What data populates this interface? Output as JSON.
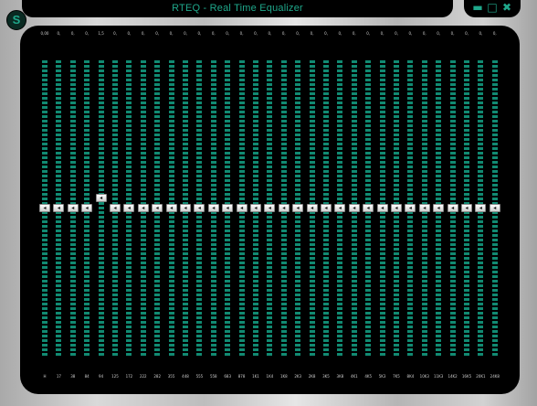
{
  "window": {
    "title": "RTEQ - Real Time Equalizer",
    "skin_button": "S",
    "minimize": "▬",
    "maximize": "□",
    "close": "✖"
  },
  "colors": {
    "accent": "#1fa88b",
    "meter": "#118a72",
    "panel": "#000000"
  },
  "equalizer": {
    "knob_glyph": "◂",
    "bands": [
      {
        "freq": "H",
        "gain": "0,00",
        "level": 0.5
      },
      {
        "freq": "17",
        "gain": "0,",
        "level": 0.5
      },
      {
        "freq": "38",
        "gain": "0,",
        "level": 0.5
      },
      {
        "freq": "84",
        "gain": "0,",
        "level": 0.5
      },
      {
        "freq": "94",
        "gain": "1,5",
        "level": 0.535
      },
      {
        "freq": "125",
        "gain": "0,",
        "level": 0.5
      },
      {
        "freq": "172",
        "gain": "0,",
        "level": 0.5
      },
      {
        "freq": "222",
        "gain": "0,",
        "level": 0.5
      },
      {
        "freq": "282",
        "gain": "0,",
        "level": 0.5
      },
      {
        "freq": "355",
        "gain": "0,",
        "level": 0.5
      },
      {
        "freq": "448",
        "gain": "0,",
        "level": 0.5
      },
      {
        "freq": "555",
        "gain": "0,",
        "level": 0.5
      },
      {
        "freq": "558",
        "gain": "0,",
        "level": 0.5
      },
      {
        "freq": "683",
        "gain": "0,",
        "level": 0.5
      },
      {
        "freq": "878",
        "gain": "0,",
        "level": 0.5
      },
      {
        "freq": "1K1",
        "gain": "0,",
        "level": 0.5
      },
      {
        "freq": "1K4",
        "gain": "0,",
        "level": 0.5
      },
      {
        "freq": "1K8",
        "gain": "0,",
        "level": 0.5
      },
      {
        "freq": "2K3",
        "gain": "0,",
        "level": 0.5
      },
      {
        "freq": "2K8",
        "gain": "0,",
        "level": 0.5
      },
      {
        "freq": "3K5",
        "gain": "0,",
        "level": 0.5
      },
      {
        "freq": "3K8",
        "gain": "0,",
        "level": 0.5
      },
      {
        "freq": "4K1",
        "gain": "0,",
        "level": 0.5
      },
      {
        "freq": "4K5",
        "gain": "0,",
        "level": 0.5
      },
      {
        "freq": "5K3",
        "gain": "0,",
        "level": 0.5
      },
      {
        "freq": "7K5",
        "gain": "0,",
        "level": 0.5
      },
      {
        "freq": "8K4",
        "gain": "0,",
        "level": 0.5
      },
      {
        "freq": "10K3",
        "gain": "0,",
        "level": 0.5
      },
      {
        "freq": "11K3",
        "gain": "0,",
        "level": 0.5
      },
      {
        "freq": "14K2",
        "gain": "0,",
        "level": 0.5
      },
      {
        "freq": "16K5",
        "gain": "0,",
        "level": 0.5
      },
      {
        "freq": "20K1",
        "gain": "0,",
        "level": 0.5
      },
      {
        "freq": "24K8",
        "gain": "0,",
        "level": 0.5
      }
    ]
  }
}
